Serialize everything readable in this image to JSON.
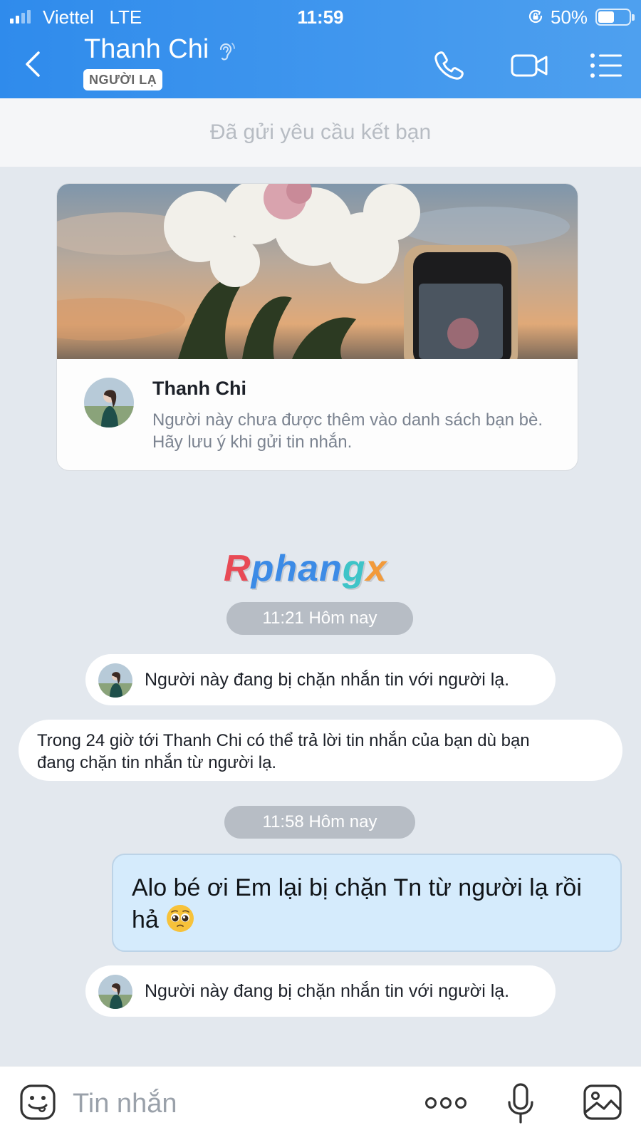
{
  "status_bar": {
    "carrier": "Viettel",
    "network": "LTE",
    "time": "11:59",
    "battery": "50%",
    "battery_level": 0.5
  },
  "header": {
    "contact_name": "Thanh Chi",
    "badge": "NGƯỜI LẠ",
    "icons": [
      "back-arrow-icon",
      "hearing-icon",
      "phone-icon",
      "video-camera-icon",
      "menu-list-icon"
    ]
  },
  "friend_request": {
    "status": "Đã gửi yêu cầu kết bạn"
  },
  "profile_card": {
    "name": "Thanh Chi",
    "note": "Người này chưa được thêm vào danh sách bạn bè. Hãy lưu ý khi gửi tin nhắn."
  },
  "watermark": {
    "r": "R",
    "mid": "phan",
    "g": "g",
    "x": "x"
  },
  "messages": [
    {
      "type": "time",
      "text": "11:21 Hôm nay"
    },
    {
      "type": "system",
      "text": "Người này đang bị chặn nhắn tin với người lạ."
    },
    {
      "type": "info",
      "line1": "Trong 24 giờ tới Thanh Chi có thể trả lời tin nhắn của bạn dù bạn",
      "line2": "đang chặn tin nhắn từ người lạ."
    },
    {
      "type": "time",
      "text": "11:58 Hôm nay"
    },
    {
      "type": "outgoing",
      "line1": "Alo bé ơi Em lại bị chặn Tn từ người lạ rồi",
      "line2": "hả",
      "emoji": "pleading-face"
    },
    {
      "type": "system",
      "text": "Người này đang bị chặn nhắn tin với người lạ."
    }
  ],
  "composer": {
    "placeholder": "Tin nhắn",
    "value": "",
    "icons": [
      "sticker-icon",
      "more-dots-icon",
      "microphone-icon",
      "image-icon"
    ]
  },
  "colors": {
    "header": "#3893ee",
    "chat_background": "#e3e8ee",
    "outgoing_bubble": "#d5ebfc",
    "time_pill": "#b7bdc5"
  }
}
